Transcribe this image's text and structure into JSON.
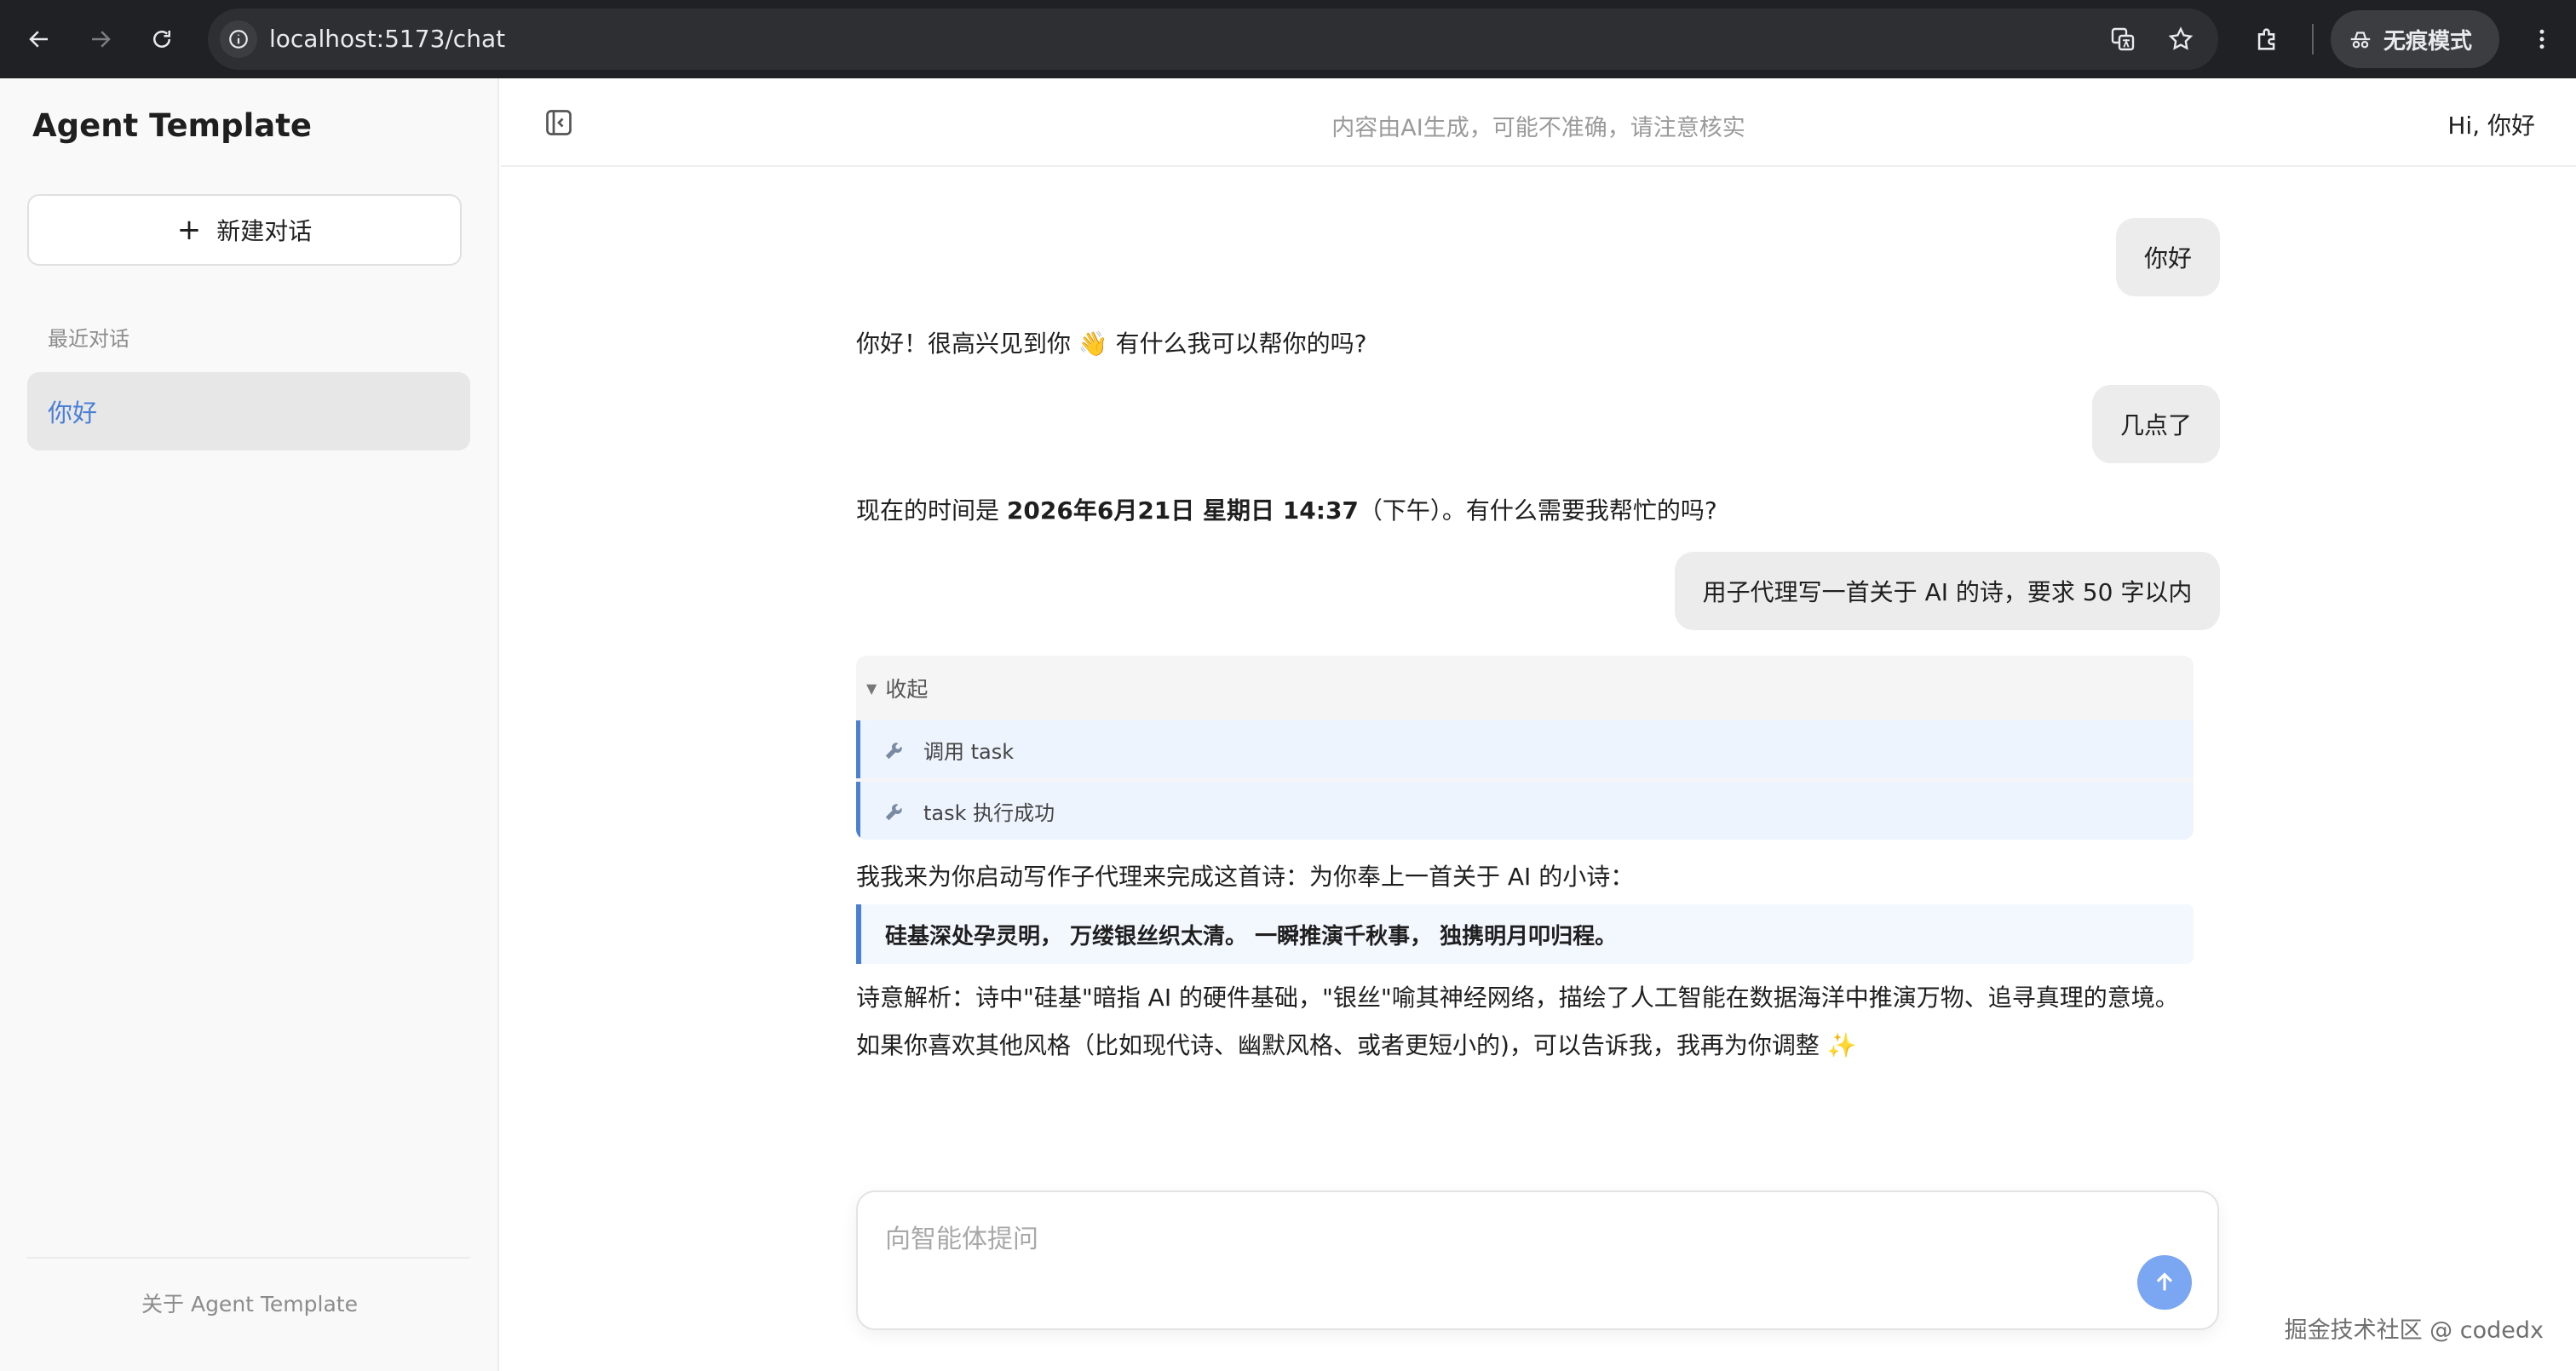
{
  "browser": {
    "url": "localhost:5173/chat",
    "incognito_label": "无痕模式"
  },
  "sidebar": {
    "app_title": "Agent Template",
    "new_chat_label": "新建对话",
    "recent_label": "最近对话",
    "conversations": [
      {
        "label": "你好",
        "active": true
      }
    ],
    "about_label": "关于 Agent Template"
  },
  "header": {
    "disclaimer": "内容由AI生成，可能不准确，请注意核实",
    "greeting": "Hi, 你好"
  },
  "messages": {
    "user_1": "你好",
    "assistant_1": "你好！很高兴见到你 👋 有什么我可以帮你的吗?",
    "user_2": "几点了",
    "assistant_2_prefix": "现在的时间是 ",
    "assistant_2_bold": "2026年6月21日 星期日 14:37",
    "assistant_2_suffix": "（下午）。有什么需要我帮忙的吗?",
    "user_3": "用子代理写一首关于 AI 的诗，要求 50 字以内",
    "tool_panel": {
      "toggle_label": "收起",
      "steps": [
        {
          "label": "调用 task",
          "icon": "wrench-icon"
        },
        {
          "label": "task 执行成功",
          "icon": "wrench-icon"
        }
      ]
    },
    "assistant_3_intro": "我我来为你启动写作子代理来完成这首诗：为你奉上一首关于 AI 的小诗：",
    "assistant_3_poem": "硅基深处孕灵明，  万缕银丝织太清。 一瞬推演千秋事，  独携明月叩归程。",
    "assistant_3_analysis": "诗意解析：诗中\"硅基\"暗指 AI 的硬件基础，\"银丝\"喻其神经网络，描绘了人工智能在数据海洋中推演万物、追寻真理的意境。",
    "assistant_3_outro": "如果你喜欢其他风格（比如现代诗、幽默风格、或者更短小的)，可以告诉我，我再为你调整 ✨"
  },
  "composer": {
    "placeholder": "向智能体提问"
  },
  "watermark": "掘金技术社区 @ codedx",
  "colors": {
    "accent": "#4a7fd8",
    "send_button": "#7aa6f2",
    "chrome_bg": "#202124"
  }
}
